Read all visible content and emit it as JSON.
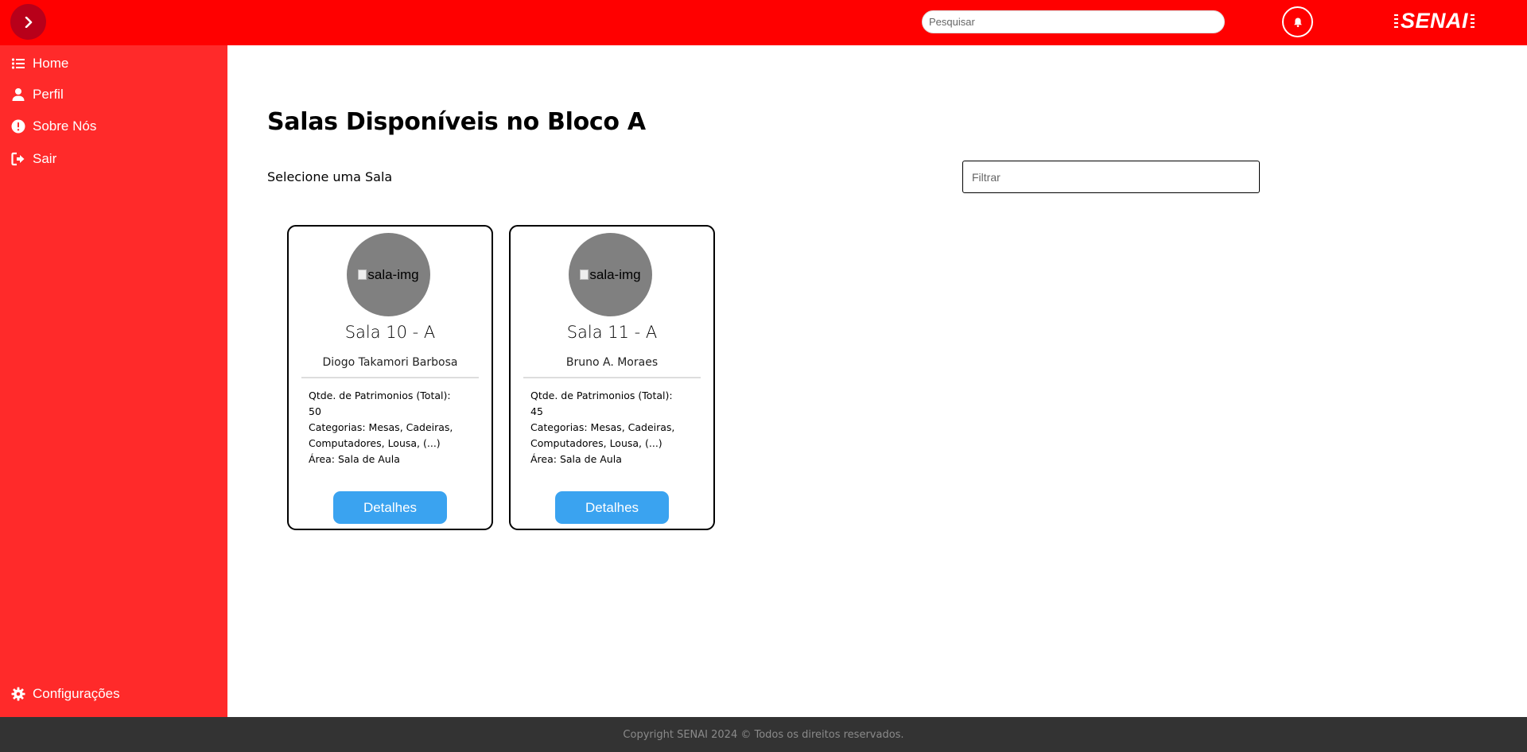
{
  "header": {
    "search_placeholder": "Pesquisar",
    "logo_text": "SENAI"
  },
  "sidebar": {
    "items": [
      {
        "label": "Home",
        "icon": "list-icon"
      },
      {
        "label": "Perfil",
        "icon": "user-icon"
      },
      {
        "label": "Sobre Nós",
        "icon": "exclamation-circle-icon"
      },
      {
        "label": "Sair",
        "icon": "sign-out-icon"
      }
    ],
    "footer_item": {
      "label": "Configurações",
      "icon": "gear-icon"
    }
  },
  "main": {
    "title": "Salas Disponíveis no Bloco A",
    "subtitle": "Selecione uma Sala",
    "filter_placeholder": "Filtrar",
    "cards": [
      {
        "img_alt": "sala-img",
        "name": "Sala 10 - A",
        "person": "Diogo Takamori Barbosa",
        "qtde_label": "Qtde. de Patrimonios (Total):",
        "qtde_value": "50",
        "categorias": "Categorias: Mesas, Cadeiras, Computadores, Lousa, (...)",
        "area": "Área: Sala de Aula",
        "button_label": "Detalhes"
      },
      {
        "img_alt": "sala-img",
        "name": "Sala 11 - A",
        "person": "Bruno A. Moraes",
        "qtde_label": "Qtde. de Patrimonios (Total):",
        "qtde_value": "45",
        "categorias": "Categorias: Mesas, Cadeiras, Computadores, Lousa, (...)",
        "area": "Área: Sala de Aula",
        "button_label": "Detalhes"
      }
    ]
  },
  "footer": {
    "text": "Copyright SENAI 2024 © Todos os direitos reservados."
  },
  "colors": {
    "topbar": "#ff0000",
    "sidebar": "#ff2a2a",
    "toggle": "#b8001a",
    "button": "#3aa3f0",
    "footer": "#333333"
  }
}
